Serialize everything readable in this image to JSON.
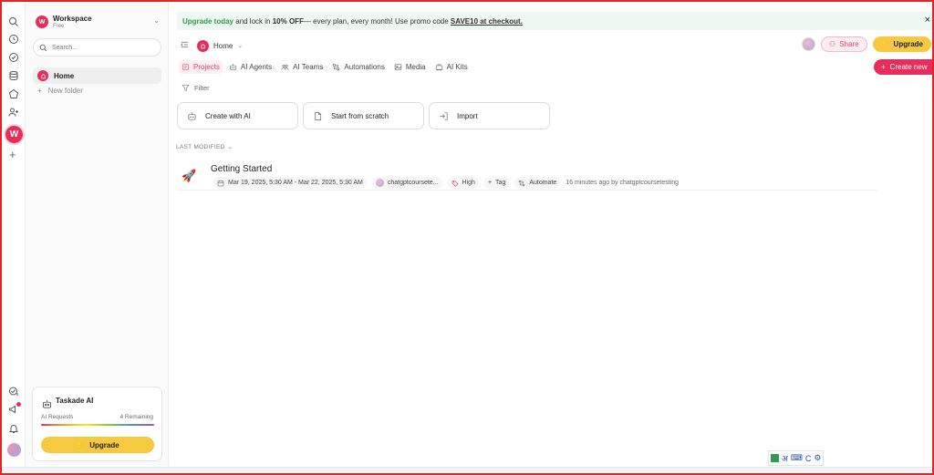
{
  "workspace": {
    "name": "Workspace",
    "plan": "Free",
    "initial": "W"
  },
  "rail": {
    "items": [
      "search-icon",
      "clock-icon",
      "check-circle-icon",
      "database-icon",
      "home-icon",
      "users-icon"
    ],
    "badge": "W",
    "add": "+"
  },
  "sidebar": {
    "search_placeholder": "Search...",
    "home_label": "Home",
    "new_folder_label": "New folder",
    "new_folder_plus": "+"
  },
  "taskade_card": {
    "title": "Taskade AI",
    "requests_label": "AI Requests",
    "remaining_label": "4 Remaining",
    "upgrade_label": "Upgrade"
  },
  "banner": {
    "link": "Upgrade today",
    "text1": " and lock in ",
    "discount": "10% OFF",
    "text2": "— every plan, every month! Use promo code ",
    "code": "SAVE10 at checkout.",
    "close": "×"
  },
  "breadcrumb": {
    "home": "Home",
    "chevron": "⌄"
  },
  "topbar": {
    "share_label": "Share",
    "upgrade_label": "Upgrade",
    "create_label": "Create new",
    "create_plus": "+"
  },
  "tabs": [
    "Projects",
    "AI Agents",
    "AI Teams",
    "Automations",
    "Media",
    "AI Kits"
  ],
  "filter_label": "Filter",
  "actions": [
    "Create with AI",
    "Start from scratch",
    "Import"
  ],
  "sort": {
    "label": "LAST MODIFIED",
    "chevron": "⌄"
  },
  "project": {
    "title": "Getting Started",
    "dates": "Mar 19, 2025, 5:30 AM - Mar 22, 2025, 5:30 AM",
    "owner": "chatgptcoursete...",
    "priority": "High",
    "tag": "Tag",
    "automate": "Automate",
    "modified": "16 minutes ago by chatgptcoursetesting"
  },
  "ime": {
    "lang": "अ",
    "mode": "C"
  },
  "colors": {
    "accent": "#e72d5c",
    "upgrade": "#f7c93e",
    "banner_bg": "#eef7f1",
    "banner_green": "#2e9b4f"
  }
}
